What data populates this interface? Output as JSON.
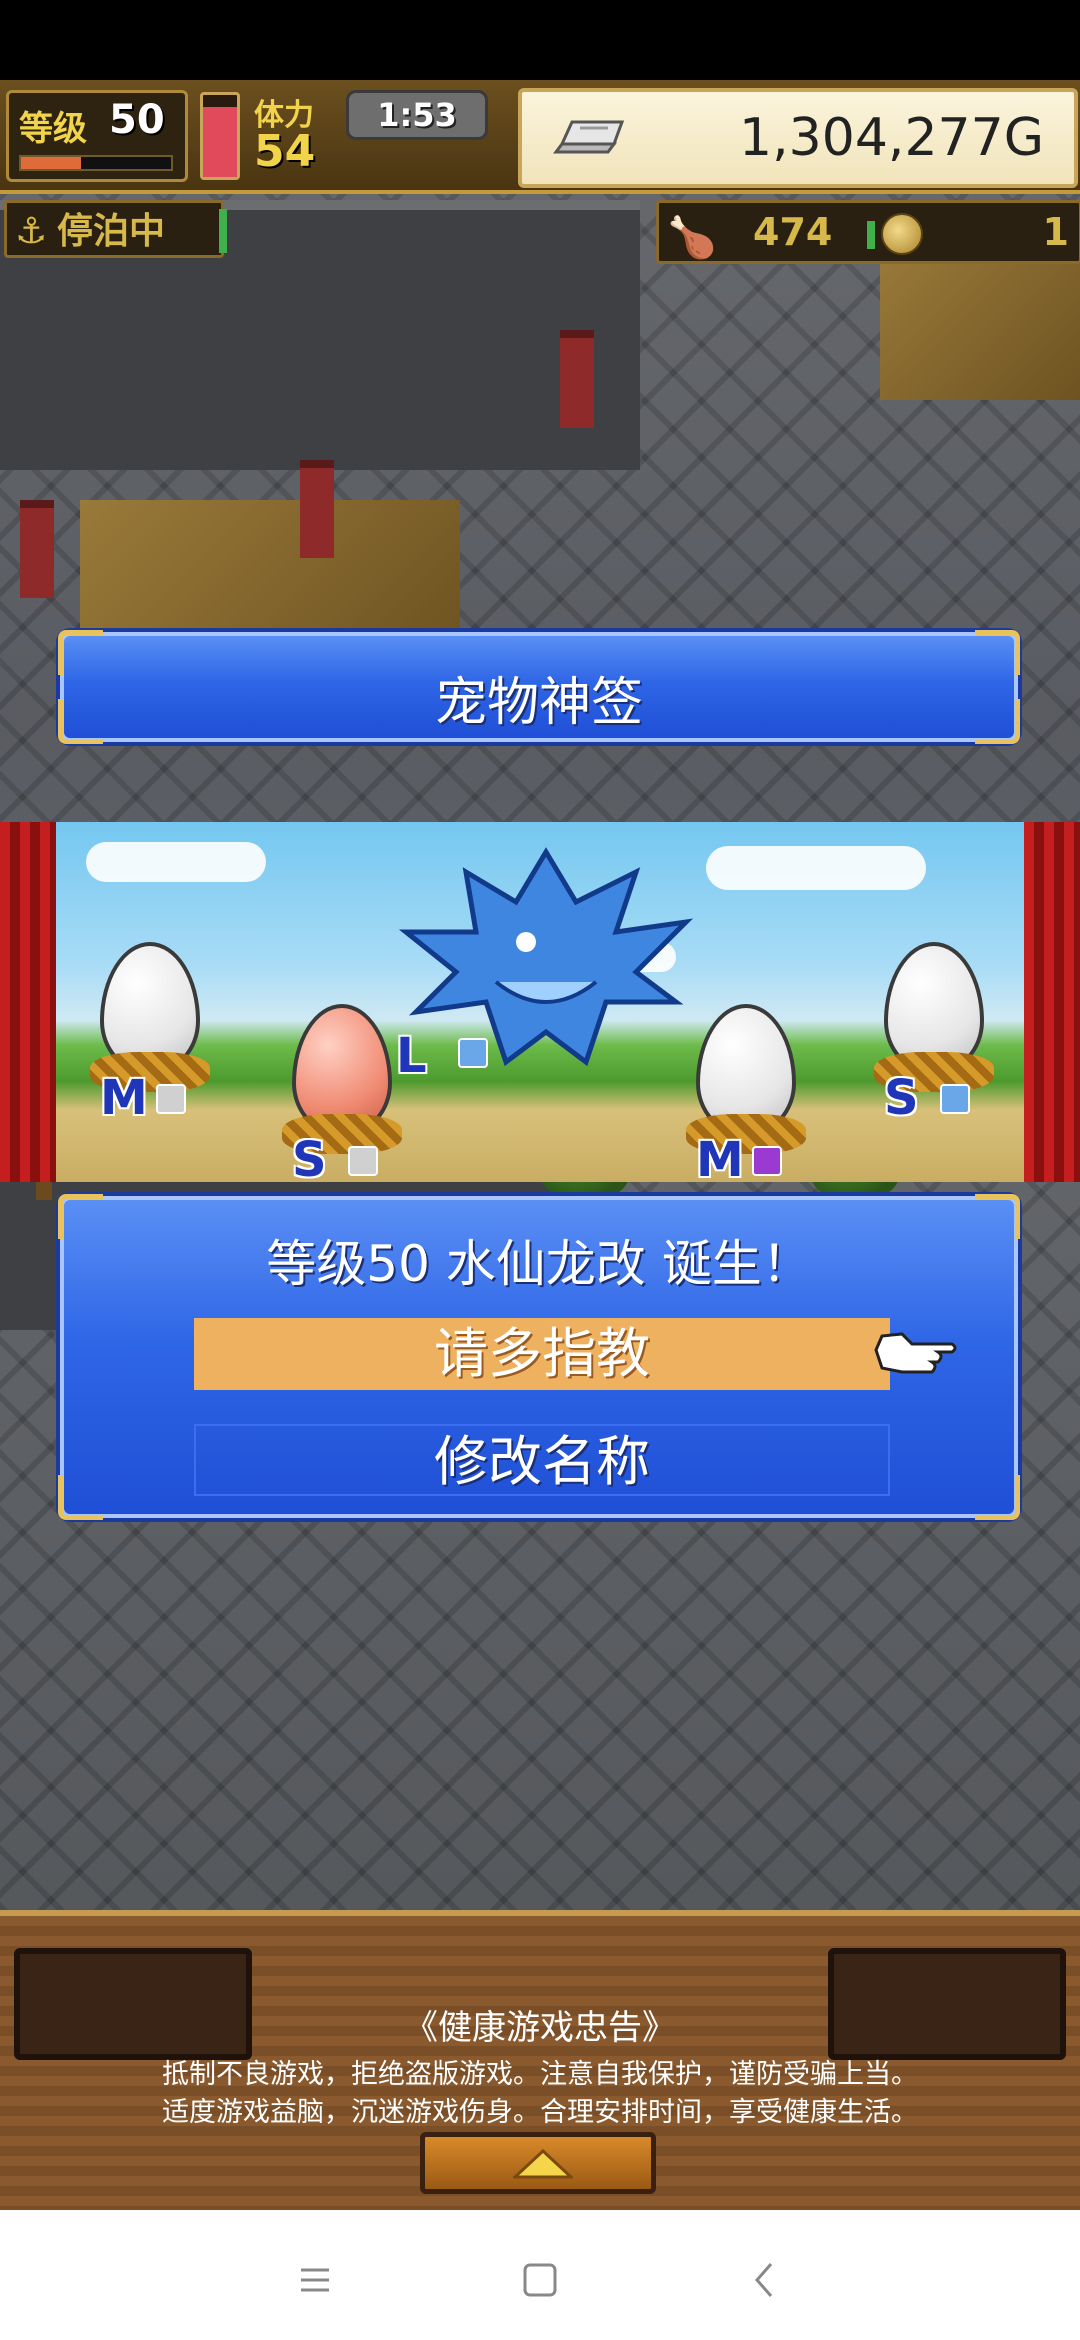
{
  "hud": {
    "level_label": "等级",
    "level_value": "50",
    "xp_progress": 0.4,
    "stamina_label": "体力",
    "stamina_value": "54",
    "stamina_progress": 0.85,
    "timer": "1:53",
    "money": "1,304,277G",
    "money_icon": "silver-ingot-icon"
  },
  "status_row": {
    "docked_label": "停泊中",
    "food_value": "474",
    "coin_value": "1"
  },
  "title_panel": {
    "title": "宠物神签"
  },
  "showcase": {
    "eggs": [
      {
        "size": "M",
        "color": "white",
        "element_color": "#d0d0d0"
      },
      {
        "size": "S",
        "color": "pink",
        "element_color": "#d0d0d0"
      },
      {
        "size": "L",
        "color": "dragon",
        "element_color": "#6aa7e8"
      },
      {
        "size": "M",
        "color": "white",
        "element_color": "#9a3ad0"
      },
      {
        "size": "S",
        "color": "white",
        "element_color": "#6aa7e8"
      }
    ]
  },
  "dialog": {
    "message": "等级50 水仙龙改 诞生！",
    "option_selected": "请多指教",
    "option_rename": "修改名称"
  },
  "bottom": {
    "health_title": "《健康游戏忠告》",
    "health_line1": "抵制不良游戏，拒绝盗版游戏。注意自我保护，谨防受骗上当。",
    "health_line2": "适度游戏益脑，沉迷游戏伤身。合理安排时间，享受健康生活。"
  },
  "colors": {
    "panel_blue": "#2f66e6",
    "selected_option": "#eeb160",
    "gold_trim": "#e8c25a"
  }
}
